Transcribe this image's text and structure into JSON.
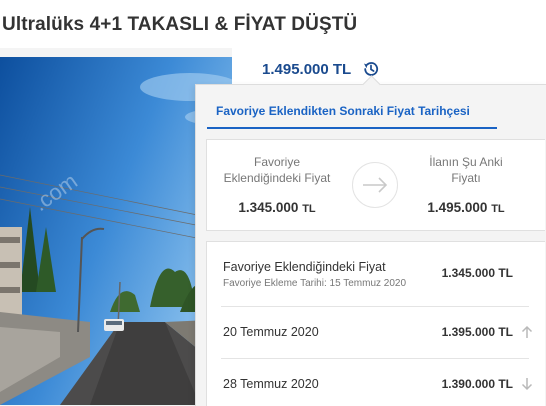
{
  "listing": {
    "title": "Ultralüks 4+1 TAKASLI & FİYAT DÜŞTÜ",
    "current_price": "1.495.000 TL"
  },
  "photo": {
    "watermark": ".com"
  },
  "price_history": {
    "tab_label": "Favoriye Eklendikten Sonraki Fiyat Tarihçesi",
    "comparison": {
      "left_label_line1": "Favoriye",
      "left_label_line2": "Eklendiğindeki Fiyat",
      "left_value": "1.345.000",
      "left_unit": "TL",
      "right_label_line1": "İlanın Şu Anki",
      "right_label_line2": "Fiyatı",
      "right_value": "1.495.000",
      "right_unit": "TL"
    },
    "entries": [
      {
        "label": "Favoriye Eklendiğindeki Fiyat",
        "sub": "Favoriye Ekleme Tarihi: 15 Temmuz 2020",
        "price": "1.345.000 TL",
        "trend": ""
      },
      {
        "label": "20 Temmuz 2020",
        "price": "1.395.000 TL",
        "trend": "up"
      },
      {
        "label": "28 Temmuz 2020",
        "price": "1.390.000 TL",
        "trend": "down"
      }
    ]
  },
  "colors": {
    "accent": "#1a63c4",
    "price_blue": "#1a4a8e",
    "trend_icon": "#b9b9b9"
  }
}
